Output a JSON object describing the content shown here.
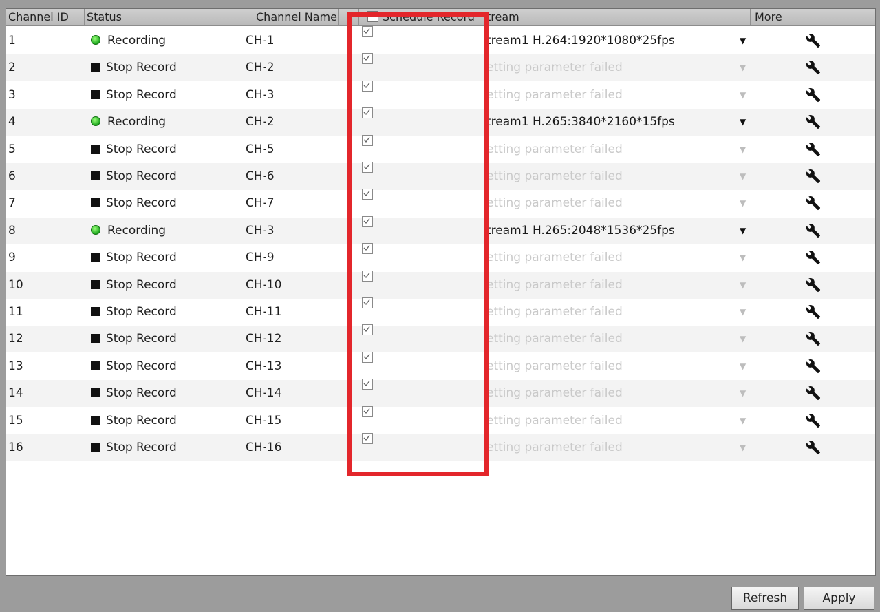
{
  "table": {
    "headers": {
      "channel_id": "Channel ID",
      "status": "Status",
      "channel_name": "Channel Name",
      "schedule_record": "Schedule Record",
      "stream": "tream",
      "more": "More"
    },
    "rows": [
      {
        "id": "1",
        "status": "Recording",
        "status_kind": "recording",
        "name": "CH-1",
        "schedule": true,
        "stream": "tream1 H.264:1920*1080*25fps",
        "stream_ok": true
      },
      {
        "id": "2",
        "status": "Stop Record",
        "status_kind": "stopped",
        "name": "CH-2",
        "schedule": true,
        "stream": "etting parameter failed",
        "stream_ok": false
      },
      {
        "id": "3",
        "status": "Stop Record",
        "status_kind": "stopped",
        "name": "CH-3",
        "schedule": true,
        "stream": "etting parameter failed",
        "stream_ok": false
      },
      {
        "id": "4",
        "status": "Recording",
        "status_kind": "recording",
        "name": "CH-2",
        "schedule": true,
        "stream": "tream1 H.265:3840*2160*15fps",
        "stream_ok": true
      },
      {
        "id": "5",
        "status": "Stop Record",
        "status_kind": "stopped",
        "name": "CH-5",
        "schedule": true,
        "stream": "etting parameter failed",
        "stream_ok": false
      },
      {
        "id": "6",
        "status": "Stop Record",
        "status_kind": "stopped",
        "name": "CH-6",
        "schedule": true,
        "stream": "etting parameter failed",
        "stream_ok": false
      },
      {
        "id": "7",
        "status": "Stop Record",
        "status_kind": "stopped",
        "name": "CH-7",
        "schedule": true,
        "stream": "etting parameter failed",
        "stream_ok": false
      },
      {
        "id": "8",
        "status": "Recording",
        "status_kind": "recording",
        "name": "CH-3",
        "schedule": true,
        "stream": "tream1 H.265:2048*1536*25fps",
        "stream_ok": true
      },
      {
        "id": "9",
        "status": "Stop Record",
        "status_kind": "stopped",
        "name": "CH-9",
        "schedule": true,
        "stream": "etting parameter failed",
        "stream_ok": false
      },
      {
        "id": "10",
        "status": "Stop Record",
        "status_kind": "stopped",
        "name": "CH-10",
        "schedule": true,
        "stream": "etting parameter failed",
        "stream_ok": false
      },
      {
        "id": "11",
        "status": "Stop Record",
        "status_kind": "stopped",
        "name": "CH-11",
        "schedule": true,
        "stream": "etting parameter failed",
        "stream_ok": false
      },
      {
        "id": "12",
        "status": "Stop Record",
        "status_kind": "stopped",
        "name": "CH-12",
        "schedule": true,
        "stream": "etting parameter failed",
        "stream_ok": false
      },
      {
        "id": "13",
        "status": "Stop Record",
        "status_kind": "stopped",
        "name": "CH-13",
        "schedule": true,
        "stream": "etting parameter failed",
        "stream_ok": false
      },
      {
        "id": "14",
        "status": "Stop Record",
        "status_kind": "stopped",
        "name": "CH-14",
        "schedule": true,
        "stream": "etting parameter failed",
        "stream_ok": false
      },
      {
        "id": "15",
        "status": "Stop Record",
        "status_kind": "stopped",
        "name": "CH-15",
        "schedule": true,
        "stream": "etting parameter failed",
        "stream_ok": false
      },
      {
        "id": "16",
        "status": "Stop Record",
        "status_kind": "stopped",
        "name": "CH-16",
        "schedule": true,
        "stream": "etting parameter failed",
        "stream_ok": false
      }
    ]
  },
  "icons": {
    "recording": "green-dot-icon",
    "stopped": "black-square-icon",
    "dropdown": "dropdown-arrow-icon",
    "more": "wrench-icon"
  },
  "colors": {
    "highlight": "#e3262b",
    "recording": "#1fa81f",
    "failed_text": "#c9c9c9"
  },
  "buttons": {
    "refresh": "Refresh",
    "apply": "Apply"
  }
}
